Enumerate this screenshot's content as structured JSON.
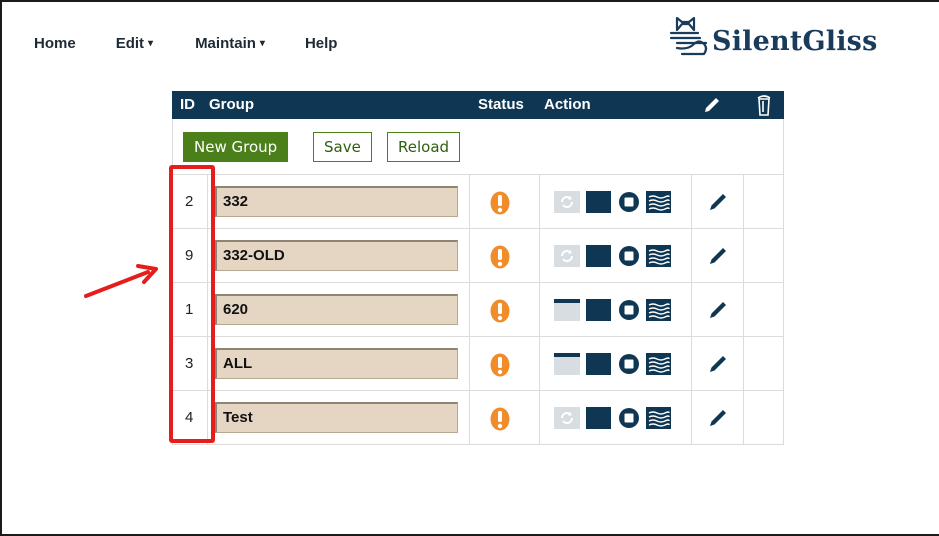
{
  "nav": {
    "home": "Home",
    "edit": "Edit",
    "maintain": "Maintain",
    "help": "Help",
    "caret": "▾"
  },
  "logo": {
    "text": "SilentGliss"
  },
  "table": {
    "headers": {
      "id": "ID",
      "group": "Group",
      "status": "Status",
      "action": "Action"
    },
    "toolbar": {
      "new_group": "New Group",
      "save": "Save",
      "reload": "Reload"
    },
    "rows": [
      {
        "id": "2",
        "group": "332",
        "first_action": "sync-disabled"
      },
      {
        "id": "9",
        "group": "332-OLD",
        "first_action": "sync-disabled"
      },
      {
        "id": "1",
        "group": "620",
        "first_action": "blind-up"
      },
      {
        "id": "3",
        "group": "ALL",
        "first_action": "blind-up"
      },
      {
        "id": "4",
        "group": "Test",
        "first_action": "sync-disabled"
      }
    ]
  },
  "colors": {
    "header_bg": "#0f3753",
    "accent_green": "#4a7f1a",
    "status_orange": "#f08c2a",
    "input_bg": "#e4d6c3",
    "annotation_red": "#e51d1d"
  }
}
